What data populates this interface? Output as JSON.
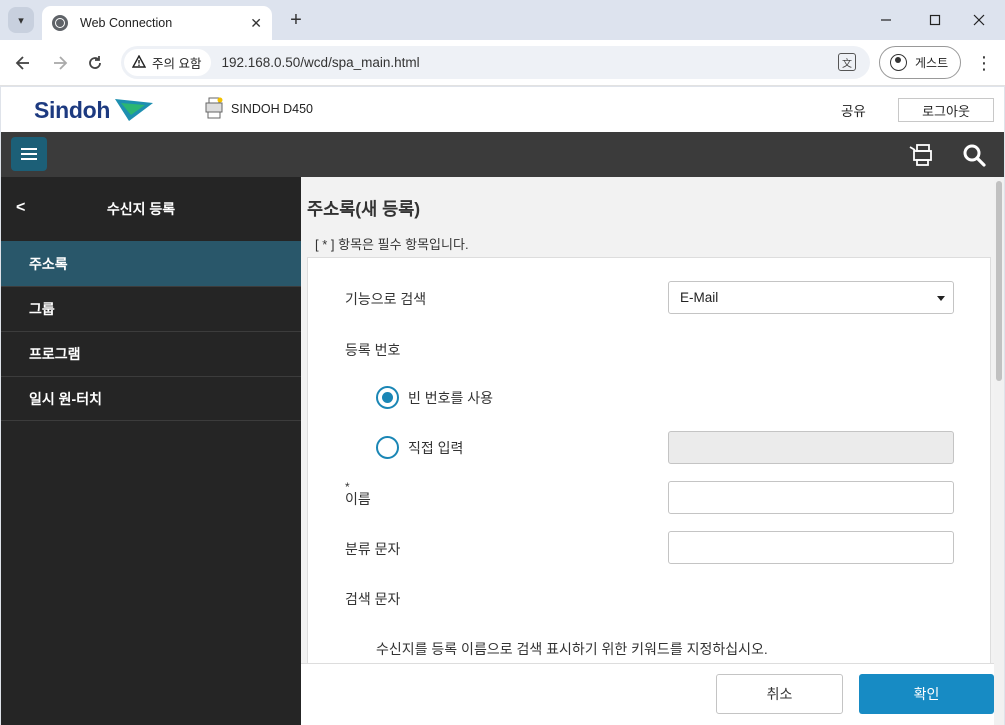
{
  "browser": {
    "tab_title": "Web Connection",
    "tab_close": "✕",
    "new_tab": "+",
    "security_label": "주의 요함",
    "url": "192.168.0.50/wcd/spa_main.html",
    "profile_label": "게스트"
  },
  "header": {
    "logo_text": "Sindoh",
    "device_name": "SINDOH D450",
    "share_label": "공유",
    "logout_label": "로그아웃"
  },
  "sidebar": {
    "back_glyph": "<",
    "title": "수신지 등록",
    "items": [
      {
        "label": "주소록"
      },
      {
        "label": "그룹"
      },
      {
        "label": "프로그램"
      },
      {
        "label": "일시 원-터치"
      }
    ]
  },
  "main": {
    "title": "주소록(새 등록)",
    "required_note": "[ * ] 항목은 필수 항목입니다.",
    "search_by_function_label": "기능으로 검색",
    "search_by_function_value": "E-Mail",
    "reg_number_label": "등록 번호",
    "radio_use_empty": "빈 번호를 사용",
    "radio_direct_input": "직접 입력",
    "required_mark": "*",
    "name_label": "이름",
    "category_label": "분류 문자",
    "search_char_label": "검색 문자",
    "search_char_help": "수신지를 등록 이름으로 검색 표시하기 위한 키워드를 지정하십시오."
  },
  "footer": {
    "cancel_label": "취소",
    "ok_label": "확인"
  },
  "colors": {
    "accent": "#178bc4",
    "sidebar_active": "#29576a",
    "menu_button": "#1c5f77"
  }
}
